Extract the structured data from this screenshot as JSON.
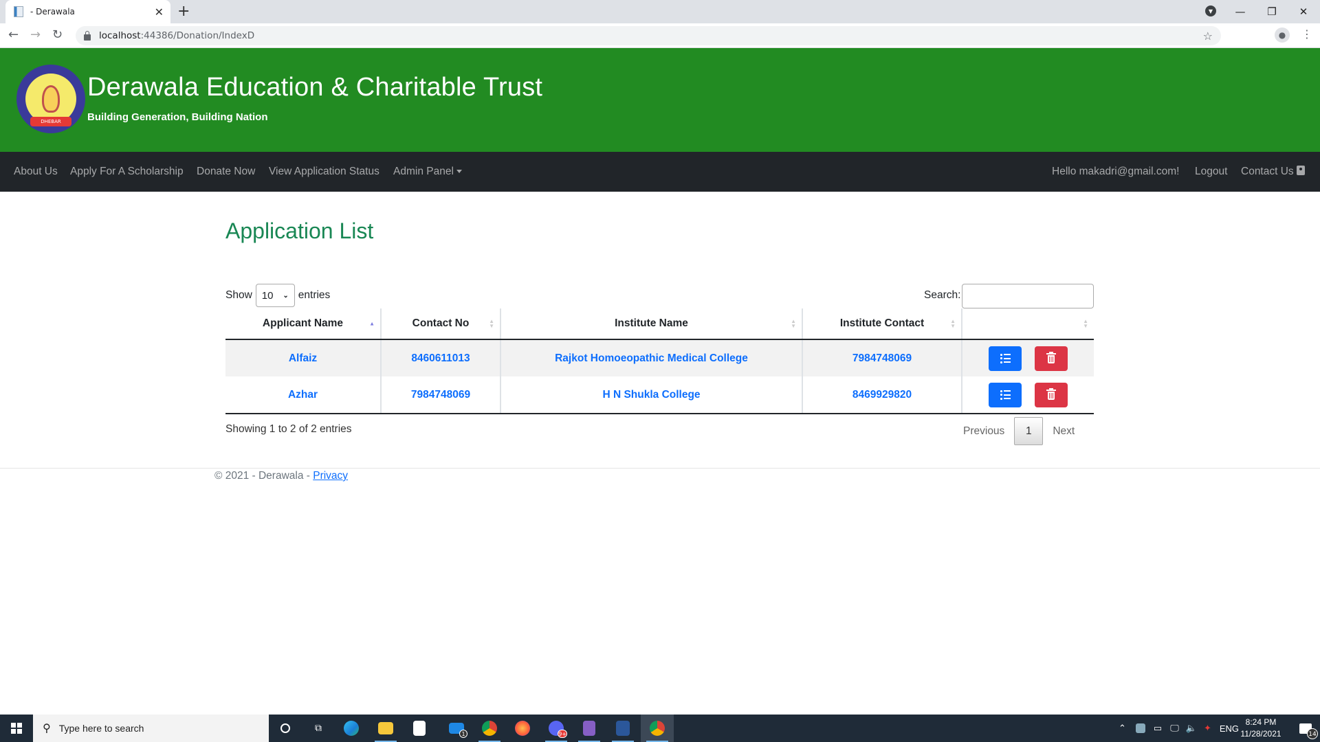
{
  "browser": {
    "tab_title": "- Derawala",
    "url_host": "localhost",
    "url_rest": ":44386/Donation/IndexD"
  },
  "site": {
    "title": "Derawala Education & Charitable Trust",
    "tagline": "Building Generation, Building Nation",
    "logo_text": "DHEBAR",
    "header_color": "#228b22"
  },
  "nav": {
    "items": [
      {
        "label": "About Us"
      },
      {
        "label": "Apply For A Scholarship"
      },
      {
        "label": "Donate Now"
      },
      {
        "label": "View Application Status"
      },
      {
        "label": "Admin Panel"
      }
    ],
    "greeting": "Hello makadri@gmail.com!",
    "logout": "Logout",
    "contact": "Contact Us"
  },
  "main": {
    "title": "Application List",
    "length": {
      "show": "Show",
      "value": "10",
      "entries": "entries"
    },
    "search": {
      "label": "Search:",
      "value": ""
    },
    "columns": [
      "Applicant Name",
      "Contact No",
      "Institute Name",
      "Institute Contact",
      ""
    ],
    "sorted_column": "Applicant Name",
    "rows": [
      {
        "applicant": "Alfaiz",
        "contact": "8460611013",
        "institute": "Rajkot Homoeopathic Medical College",
        "institute_contact": "7984748069"
      },
      {
        "applicant": "Azhar",
        "contact": "7984748069",
        "institute": "H N Shukla College",
        "institute_contact": "8469929820"
      }
    ],
    "info": "Showing 1 to 2 of 2 entries",
    "pagination": {
      "previous": "Previous",
      "current": "1",
      "next": "Next"
    }
  },
  "footer": {
    "text": "© 2021 - Derawala - ",
    "privacy": "Privacy"
  },
  "taskbar": {
    "search_placeholder": "Type here to search",
    "mail_badge": "1",
    "discord_badge": "9+",
    "language": "ENG",
    "time": "8:24 PM",
    "date": "11/28/2021",
    "notifications": "14"
  }
}
